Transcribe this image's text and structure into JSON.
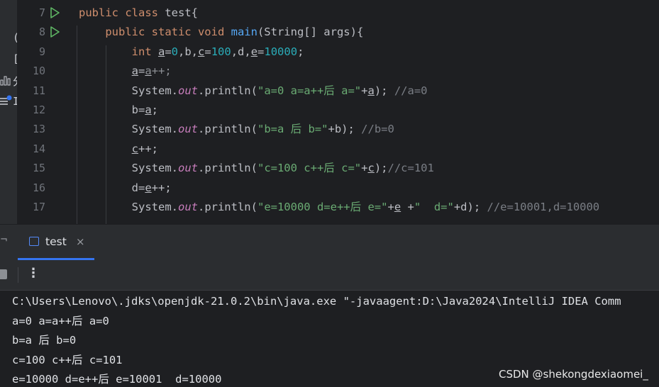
{
  "toolstrip": {
    "glyphs": [
      "(",
      "[",
      "分",
      "I"
    ],
    "icons": [
      "bar-chart-icon",
      "list-notification-icon"
    ]
  },
  "editor": {
    "line_numbers": [
      "7",
      "8",
      "9",
      "10",
      "11",
      "12",
      "13",
      "14",
      "15",
      "16",
      "17"
    ],
    "run_gutter_lines": [
      "7",
      "8"
    ],
    "lines": [
      {
        "n": "7",
        "tokens": [
          {
            "t": "public class ",
            "c": "kw"
          },
          {
            "t": "test{",
            "c": ""
          }
        ]
      },
      {
        "n": "8",
        "tokens": [
          {
            "t": "    public static void ",
            "c": "kw"
          },
          {
            "t": "main",
            "c": "fn"
          },
          {
            "t": "(String[] args){",
            "c": ""
          }
        ]
      },
      {
        "n": "9",
        "tokens": [
          {
            "t": "        int ",
            "c": "kw"
          },
          {
            "t": "a",
            "c": "ul"
          },
          {
            "t": "=",
            "c": ""
          },
          {
            "t": "0",
            "c": "num"
          },
          {
            "t": ",b,",
            "c": ""
          },
          {
            "t": "c",
            "c": "ul"
          },
          {
            "t": "=",
            "c": ""
          },
          {
            "t": "100",
            "c": "num"
          },
          {
            "t": ",d,",
            "c": ""
          },
          {
            "t": "e",
            "c": "ul"
          },
          {
            "t": "=",
            "c": ""
          },
          {
            "t": "10000",
            "c": "num"
          },
          {
            "t": ";",
            "c": ""
          }
        ]
      },
      {
        "n": "10",
        "tokens": [
          {
            "t": "        ",
            "c": ""
          },
          {
            "t": "a",
            "c": "ul"
          },
          {
            "t": "=",
            "c": ""
          },
          {
            "t": "a",
            "c": "ul gray"
          },
          {
            "t": "++;",
            "c": "gray"
          }
        ]
      },
      {
        "n": "11",
        "tokens": [
          {
            "t": "        System.",
            "c": ""
          },
          {
            "t": "out",
            "c": "fld"
          },
          {
            "t": ".println(",
            "c": ""
          },
          {
            "t": "\"a=0 a=a++后 a=\"",
            "c": "str"
          },
          {
            "t": "+",
            "c": ""
          },
          {
            "t": "a",
            "c": "ul"
          },
          {
            "t": "); ",
            "c": ""
          },
          {
            "t": "//a=0",
            "c": "cmt"
          }
        ]
      },
      {
        "n": "12",
        "tokens": [
          {
            "t": "        b=",
            "c": ""
          },
          {
            "t": "a",
            "c": "ul"
          },
          {
            "t": ";",
            "c": ""
          }
        ]
      },
      {
        "n": "13",
        "tokens": [
          {
            "t": "        System.",
            "c": ""
          },
          {
            "t": "out",
            "c": "fld"
          },
          {
            "t": ".println(",
            "c": ""
          },
          {
            "t": "\"b=a 后 b=\"",
            "c": "str"
          },
          {
            "t": "+b); ",
            "c": ""
          },
          {
            "t": "//b=0",
            "c": "cmt"
          }
        ]
      },
      {
        "n": "14",
        "tokens": [
          {
            "t": "        ",
            "c": ""
          },
          {
            "t": "c",
            "c": "ul"
          },
          {
            "t": "++;",
            "c": ""
          }
        ]
      },
      {
        "n": "15",
        "tokens": [
          {
            "t": "        System.",
            "c": ""
          },
          {
            "t": "out",
            "c": "fld"
          },
          {
            "t": ".println(",
            "c": ""
          },
          {
            "t": "\"c=100 c++后 c=\"",
            "c": "str"
          },
          {
            "t": "+",
            "c": ""
          },
          {
            "t": "c",
            "c": "ul"
          },
          {
            "t": ");",
            "c": ""
          },
          {
            "t": "//c=101",
            "c": "cmt"
          }
        ]
      },
      {
        "n": "16",
        "tokens": [
          {
            "t": "        d=",
            "c": ""
          },
          {
            "t": "e",
            "c": "ul"
          },
          {
            "t": "++;",
            "c": ""
          }
        ]
      },
      {
        "n": "17",
        "tokens": [
          {
            "t": "        System.",
            "c": ""
          },
          {
            "t": "out",
            "c": "fld"
          },
          {
            "t": ".println(",
            "c": ""
          },
          {
            "t": "\"e=10000 d=e++后 e=\"",
            "c": "str"
          },
          {
            "t": "+",
            "c": ""
          },
          {
            "t": "e",
            "c": "ul"
          },
          {
            "t": " +",
            "c": ""
          },
          {
            "t": "\"  d=\"",
            "c": "str"
          },
          {
            "t": "+d); ",
            "c": ""
          },
          {
            "t": "//e=10001,d=10000",
            "c": "cmt"
          }
        ]
      }
    ]
  },
  "run_panel": {
    "tab_label": "test",
    "tab_close": "×",
    "more_label": "⋮",
    "edge_glyph": "¬"
  },
  "console": {
    "lines": [
      "C:\\Users\\Lenovo\\.jdks\\openjdk-21.0.2\\bin\\java.exe \"-javaagent:D:\\Java2024\\IntelliJ IDEA Comm",
      "a=0 a=a++后 a=0",
      "b=a 后 b=0",
      "c=100 c++后 c=101",
      "e=10000 d=e++后 e=10001  d=10000"
    ]
  },
  "watermark": "CSDN @shekongdexiaomei_",
  "colors": {
    "keyword": "#cf8e6d",
    "function": "#56a8f5",
    "number": "#2aacb8",
    "string": "#6aab73",
    "comment": "#7a7e85",
    "field": "#c77dbb",
    "accent": "#3574f0",
    "run_icon": "#5fb865"
  }
}
